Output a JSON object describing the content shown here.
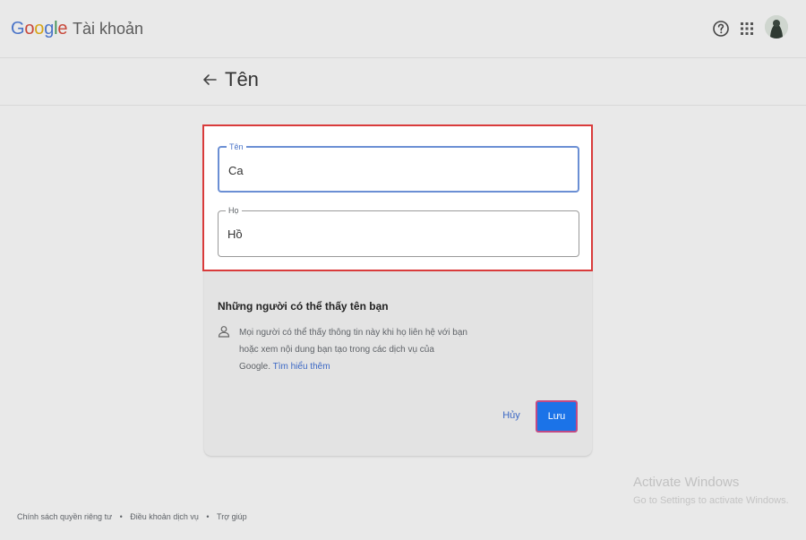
{
  "header": {
    "logo": "Google",
    "product": "Tài khoản",
    "help_icon": "help-circle-icon",
    "apps_icon": "apps-grid-icon",
    "avatar_icon": "avatar"
  },
  "page": {
    "title": "Tên",
    "back_icon": "arrow-back-icon"
  },
  "form": {
    "first_name": {
      "label": "Tên",
      "value": "Ca"
    },
    "last_name": {
      "label": "Họ",
      "value": "Hồ"
    }
  },
  "info": {
    "heading": "Những người có thể thấy tên bạn",
    "line1": "Mọi người có thể thấy thông tin này khi họ liên hệ với bạn",
    "line2": "hoặc xem nội dung bạn tạo trong các dịch vụ của",
    "line3_prefix": "Google. ",
    "link": "Tìm hiểu thêm",
    "icon": "person-icon"
  },
  "actions": {
    "cancel": "Hủy",
    "save": "Lưu"
  },
  "watermark": {
    "title": "Activate Windows",
    "subtitle": "Go to Settings to activate Windows."
  },
  "footer": {
    "privacy": "Chính sách quyền riêng tư",
    "terms": "Điều khoản dịch vụ",
    "help": "Trợ giúp",
    "separator": "•"
  },
  "colors": {
    "accent": "#1b73e8",
    "highlight": "#d93b3b",
    "link": "#3a67c4"
  }
}
